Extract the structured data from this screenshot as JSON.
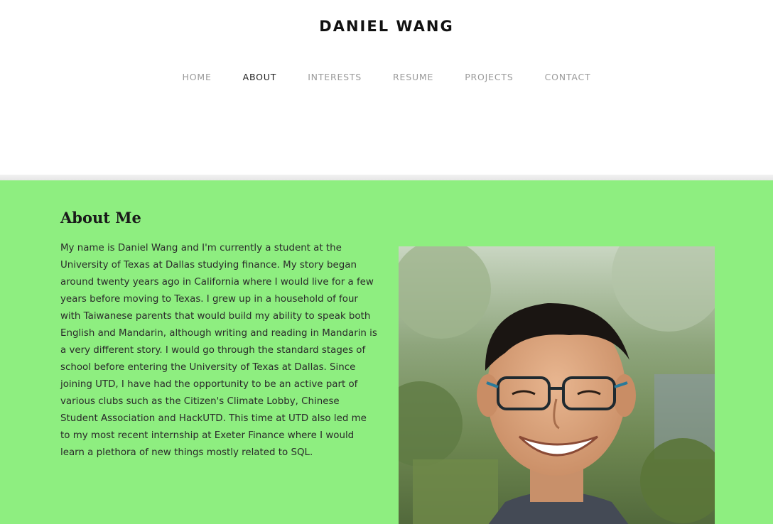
{
  "site": {
    "title": "DANIEL WANG"
  },
  "nav": {
    "items": [
      {
        "label": "HOME",
        "active": false
      },
      {
        "label": "ABOUT",
        "active": true
      },
      {
        "label": "INTERESTS",
        "active": false
      },
      {
        "label": "RESUME",
        "active": false
      },
      {
        "label": "PROJECTS",
        "active": false
      },
      {
        "label": "CONTACT",
        "active": false
      }
    ]
  },
  "about": {
    "heading": "About Me",
    "body": "My name is Daniel Wang and I'm currently a student at the University of Texas at Dallas studying finance. My story began around twenty years ago in California where I would live for a few years before moving to Texas. I grew up in a household of four with Taiwanese parents that would build my ability to speak both English and Mandarin, although writing and reading in Mandarin is a very different story. I would go through the standard stages of school before entering the University of Texas at Dallas. Since joining UTD, I have had the opportunity to be an active part of various clubs such as the Citizen's Climate Lobby, Chinese Student Association and HackUTD. This time at UTD also led me to my most recent internship at Exeter Finance where I would learn a plethora of new things mostly related to SQL."
  },
  "colors": {
    "content_background": "#8eee80",
    "nav_active": "#222222",
    "nav_inactive": "#9a9a9a"
  }
}
